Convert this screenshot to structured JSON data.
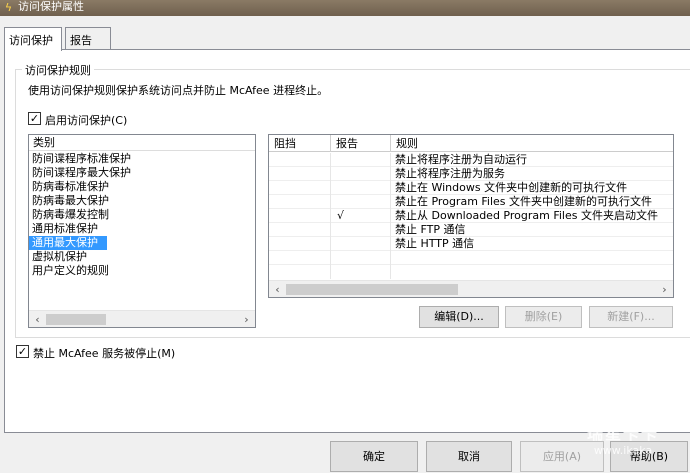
{
  "window": {
    "title": "访问保护属性"
  },
  "tabs": [
    {
      "label": "访问保护"
    },
    {
      "label": "报告"
    }
  ],
  "group": {
    "title": "访问保护规则",
    "description": "使用访问保护规则保护系统访问点并防止 McAfee 进程终止。"
  },
  "enable_checkbox": {
    "label": "启用访问保护(C)",
    "checked": "✓"
  },
  "categories": {
    "header": "类别",
    "items": [
      "防间谍程序标准保护",
      "防间谍程序最大保护",
      "防病毒标准保护",
      "防病毒最大保护",
      "防病毒爆发控制",
      "通用标准保护",
      "通用最大保护",
      "虚拟机保护",
      "用户定义的规则"
    ],
    "selected_index": 6
  },
  "rules": {
    "columns": [
      "阻挡",
      "报告",
      "规则"
    ],
    "rows": [
      {
        "block": "",
        "report": "",
        "rule": "禁止将程序注册为自动运行"
      },
      {
        "block": "",
        "report": "",
        "rule": "禁止将程序注册为服务"
      },
      {
        "block": "",
        "report": "",
        "rule": "禁止在 Windows 文件夹中创建新的可执行文件"
      },
      {
        "block": "",
        "report": "",
        "rule": "禁止在 Program Files 文件夹中创建新的可执行文件"
      },
      {
        "block": "",
        "report": "√",
        "rule": "禁止从 Downloaded Program Files 文件夹启动文件"
      },
      {
        "block": "",
        "report": "",
        "rule": "禁止 FTP 通信"
      },
      {
        "block": "",
        "report": "",
        "rule": "禁止 HTTP 通信"
      }
    ]
  },
  "rule_buttons": {
    "edit": "编辑(D)...",
    "delete": "删除(E)",
    "new": "新建(F)..."
  },
  "service_checkbox": {
    "label": "禁止 McAfee 服务被停止(M)",
    "checked": "✓"
  },
  "dialog_buttons": {
    "ok": "确定",
    "cancel": "取消",
    "apply": "应用(A)",
    "help": "帮助(B)"
  },
  "watermark": {
    "title": "瑞星卡卡",
    "url": "www.ikaka"
  },
  "icons": {
    "app": "mcafee-shield-icon",
    "scroll_left": "chevron-left-icon",
    "scroll_right": "chevron-right-icon"
  }
}
